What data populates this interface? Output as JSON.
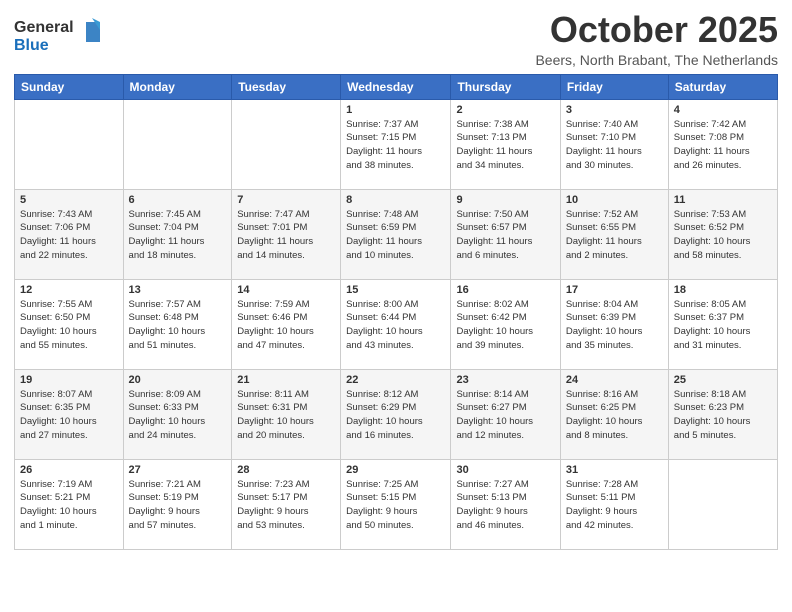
{
  "header": {
    "logo": {
      "line1": "General",
      "line2": "Blue"
    },
    "title": "October 2025",
    "subtitle": "Beers, North Brabant, The Netherlands"
  },
  "weekdays": [
    "Sunday",
    "Monday",
    "Tuesday",
    "Wednesday",
    "Thursday",
    "Friday",
    "Saturday"
  ],
  "weeks": [
    [
      {
        "day": "",
        "info": ""
      },
      {
        "day": "",
        "info": ""
      },
      {
        "day": "",
        "info": ""
      },
      {
        "day": "1",
        "info": "Sunrise: 7:37 AM\nSunset: 7:15 PM\nDaylight: 11 hours\nand 38 minutes."
      },
      {
        "day": "2",
        "info": "Sunrise: 7:38 AM\nSunset: 7:13 PM\nDaylight: 11 hours\nand 34 minutes."
      },
      {
        "day": "3",
        "info": "Sunrise: 7:40 AM\nSunset: 7:10 PM\nDaylight: 11 hours\nand 30 minutes."
      },
      {
        "day": "4",
        "info": "Sunrise: 7:42 AM\nSunset: 7:08 PM\nDaylight: 11 hours\nand 26 minutes."
      }
    ],
    [
      {
        "day": "5",
        "info": "Sunrise: 7:43 AM\nSunset: 7:06 PM\nDaylight: 11 hours\nand 22 minutes."
      },
      {
        "day": "6",
        "info": "Sunrise: 7:45 AM\nSunset: 7:04 PM\nDaylight: 11 hours\nand 18 minutes."
      },
      {
        "day": "7",
        "info": "Sunrise: 7:47 AM\nSunset: 7:01 PM\nDaylight: 11 hours\nand 14 minutes."
      },
      {
        "day": "8",
        "info": "Sunrise: 7:48 AM\nSunset: 6:59 PM\nDaylight: 11 hours\nand 10 minutes."
      },
      {
        "day": "9",
        "info": "Sunrise: 7:50 AM\nSunset: 6:57 PM\nDaylight: 11 hours\nand 6 minutes."
      },
      {
        "day": "10",
        "info": "Sunrise: 7:52 AM\nSunset: 6:55 PM\nDaylight: 11 hours\nand 2 minutes."
      },
      {
        "day": "11",
        "info": "Sunrise: 7:53 AM\nSunset: 6:52 PM\nDaylight: 10 hours\nand 58 minutes."
      }
    ],
    [
      {
        "day": "12",
        "info": "Sunrise: 7:55 AM\nSunset: 6:50 PM\nDaylight: 10 hours\nand 55 minutes."
      },
      {
        "day": "13",
        "info": "Sunrise: 7:57 AM\nSunset: 6:48 PM\nDaylight: 10 hours\nand 51 minutes."
      },
      {
        "day": "14",
        "info": "Sunrise: 7:59 AM\nSunset: 6:46 PM\nDaylight: 10 hours\nand 47 minutes."
      },
      {
        "day": "15",
        "info": "Sunrise: 8:00 AM\nSunset: 6:44 PM\nDaylight: 10 hours\nand 43 minutes."
      },
      {
        "day": "16",
        "info": "Sunrise: 8:02 AM\nSunset: 6:42 PM\nDaylight: 10 hours\nand 39 minutes."
      },
      {
        "day": "17",
        "info": "Sunrise: 8:04 AM\nSunset: 6:39 PM\nDaylight: 10 hours\nand 35 minutes."
      },
      {
        "day": "18",
        "info": "Sunrise: 8:05 AM\nSunset: 6:37 PM\nDaylight: 10 hours\nand 31 minutes."
      }
    ],
    [
      {
        "day": "19",
        "info": "Sunrise: 8:07 AM\nSunset: 6:35 PM\nDaylight: 10 hours\nand 27 minutes."
      },
      {
        "day": "20",
        "info": "Sunrise: 8:09 AM\nSunset: 6:33 PM\nDaylight: 10 hours\nand 24 minutes."
      },
      {
        "day": "21",
        "info": "Sunrise: 8:11 AM\nSunset: 6:31 PM\nDaylight: 10 hours\nand 20 minutes."
      },
      {
        "day": "22",
        "info": "Sunrise: 8:12 AM\nSunset: 6:29 PM\nDaylight: 10 hours\nand 16 minutes."
      },
      {
        "day": "23",
        "info": "Sunrise: 8:14 AM\nSunset: 6:27 PM\nDaylight: 10 hours\nand 12 minutes."
      },
      {
        "day": "24",
        "info": "Sunrise: 8:16 AM\nSunset: 6:25 PM\nDaylight: 10 hours\nand 8 minutes."
      },
      {
        "day": "25",
        "info": "Sunrise: 8:18 AM\nSunset: 6:23 PM\nDaylight: 10 hours\nand 5 minutes."
      }
    ],
    [
      {
        "day": "26",
        "info": "Sunrise: 7:19 AM\nSunset: 5:21 PM\nDaylight: 10 hours\nand 1 minute."
      },
      {
        "day": "27",
        "info": "Sunrise: 7:21 AM\nSunset: 5:19 PM\nDaylight: 9 hours\nand 57 minutes."
      },
      {
        "day": "28",
        "info": "Sunrise: 7:23 AM\nSunset: 5:17 PM\nDaylight: 9 hours\nand 53 minutes."
      },
      {
        "day": "29",
        "info": "Sunrise: 7:25 AM\nSunset: 5:15 PM\nDaylight: 9 hours\nand 50 minutes."
      },
      {
        "day": "30",
        "info": "Sunrise: 7:27 AM\nSunset: 5:13 PM\nDaylight: 9 hours\nand 46 minutes."
      },
      {
        "day": "31",
        "info": "Sunrise: 7:28 AM\nSunset: 5:11 PM\nDaylight: 9 hours\nand 42 minutes."
      },
      {
        "day": "",
        "info": ""
      }
    ]
  ]
}
